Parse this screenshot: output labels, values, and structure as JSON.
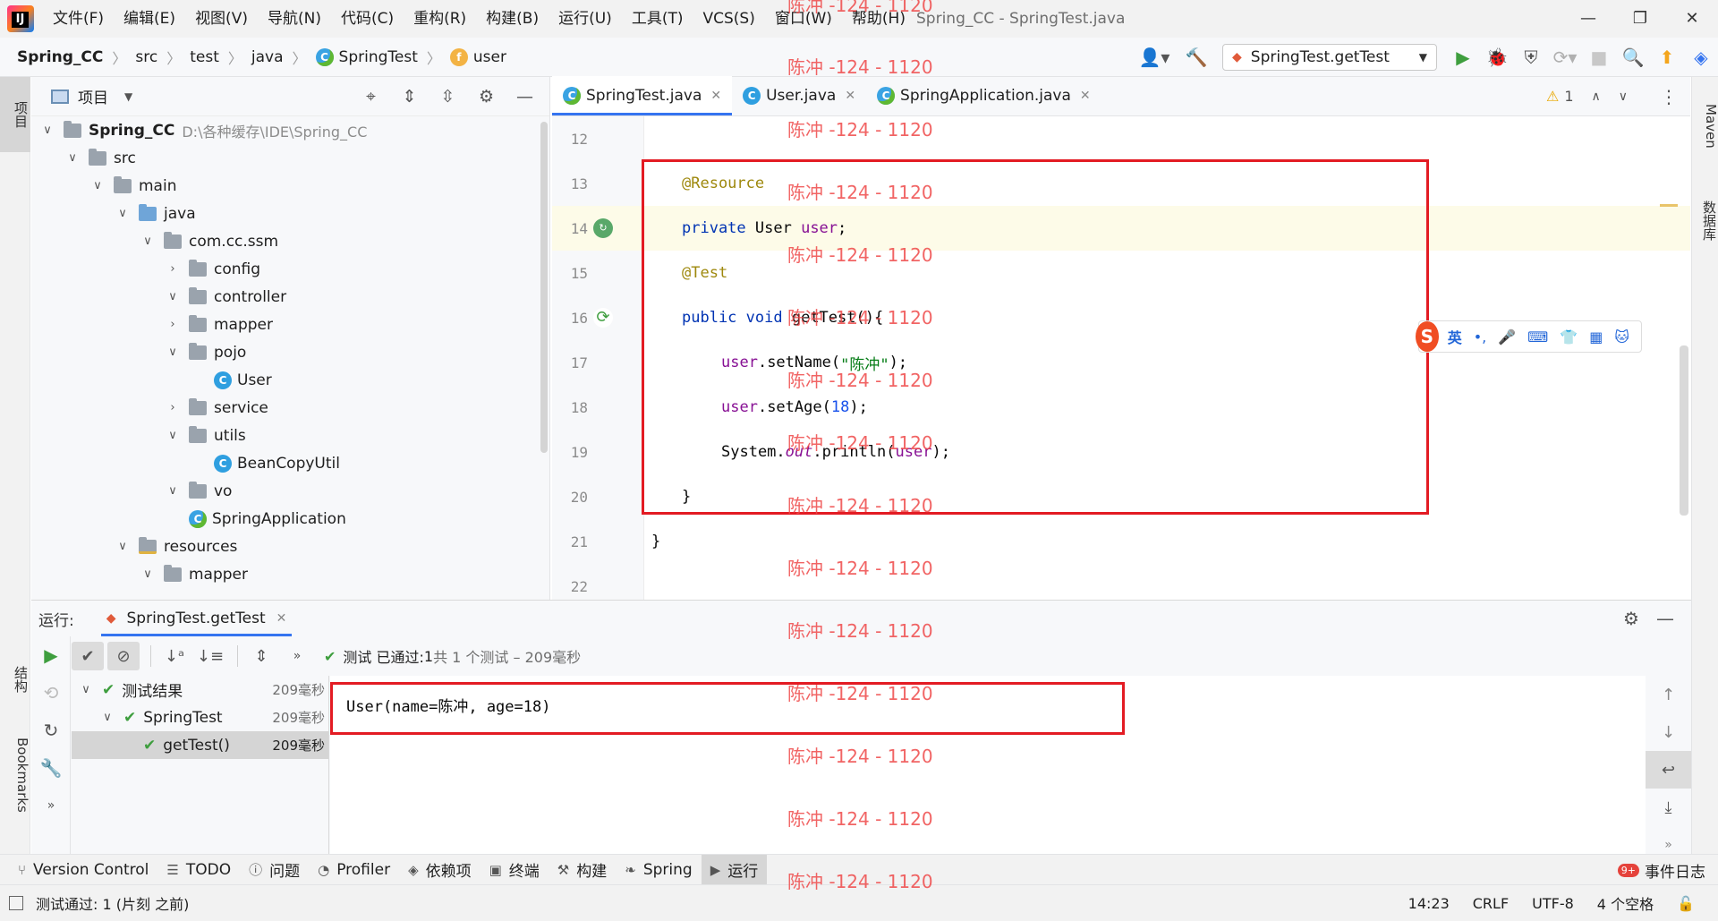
{
  "menu": {
    "items": [
      "文件(F)",
      "编辑(E)",
      "视图(V)",
      "导航(N)",
      "代码(C)",
      "重构(R)",
      "构建(B)",
      "运行(U)",
      "工具(T)",
      "VCS(S)",
      "窗口(W)",
      "帮助(H)"
    ],
    "window_title": "Spring_CC - SpringTest.java"
  },
  "breadcrumb": {
    "project": "Spring_CC",
    "path": [
      "src",
      "test",
      "java"
    ],
    "class": "SpringTest",
    "member": "user"
  },
  "toolbar": {
    "run_config": "SpringTest.getTest"
  },
  "left_stripe": {
    "project_tab": "项目",
    "structure_tab": "结构",
    "bookmarks_tab": "Bookmarks"
  },
  "right_stripe": {
    "maven_tab": "Maven",
    "database_tab": "数据库"
  },
  "project_panel": {
    "title": "项目",
    "root_name": "Spring_CC",
    "root_path": "D:\\各种缓存\\IDE\\Spring_CC",
    "nodes": [
      "src",
      "main",
      "java",
      "com.cc.ssm",
      "config",
      "controller",
      "mapper",
      "pojo",
      "User",
      "service",
      "utils",
      "BeanCopyUtil",
      "vo",
      "SpringApplication",
      "resources",
      "mapper"
    ]
  },
  "editor": {
    "tabs": [
      "SpringTest.java",
      "User.java",
      "SpringApplication.java"
    ],
    "inspection_count": "1",
    "line_numbers": [
      "12",
      "13",
      "14",
      "15",
      "16",
      "17",
      "18",
      "19",
      "20",
      "21",
      "22"
    ],
    "code": {
      "l13_annotation": "@Resource",
      "l14_kw": "private",
      "l14_type": " User ",
      "l14_field": "user",
      "l14_end": ";",
      "l15_annotation": "@Test",
      "l16_kw1": "public",
      "l16_kw2": " void",
      "l16_rest": " getTest(){",
      "l17_field": "user",
      "l17_call": ".setName(",
      "l17_str": "\"陈冲\"",
      "l17_end": ");",
      "l18_field": "user",
      "l18_call": ".setAge(",
      "l18_num": "18",
      "l18_end": ");",
      "l19_sys": "System.",
      "l19_out": "out",
      "l19_call": ".println(",
      "l19_field": "user",
      "l19_end": ");",
      "l20": "}",
      "l21": "}"
    }
  },
  "ime": {
    "logo": "S",
    "lang": "英",
    "items": [
      "•,",
      "🎤",
      "⌨",
      "👕",
      "▦",
      "🐱"
    ]
  },
  "run_panel": {
    "label": "运行:",
    "tab": "SpringTest.getTest",
    "status_prefix": "测试 已通过: ",
    "status_count": "1",
    "status_detail": "共 1 个测试 – 209毫秒",
    "tree": [
      {
        "label": "测试结果",
        "time": "209毫秒"
      },
      {
        "label": "SpringTest",
        "time": "209毫秒"
      },
      {
        "label": "getTest()",
        "time": "209毫秒"
      }
    ],
    "console_output": "User(name=陈冲, age=18)"
  },
  "tool_windows": {
    "items": [
      "Version Control",
      "TODO",
      "问题",
      "Profiler",
      "依赖项",
      "终端",
      "构建",
      "Spring",
      "运行"
    ],
    "event_badge": "9+",
    "event_log": "事件日志"
  },
  "status_bar": {
    "message": "测试通过: 1 (片刻 之前)",
    "position": "14:23",
    "line_sep": "CRLF",
    "encoding": "UTF-8",
    "indent": "4 个空格"
  },
  "watermark": {
    "text": "陈冲 -124 - 1120"
  },
  "colors": {
    "accent": "#3574f0",
    "highlight_box": "#e31b23",
    "pass_green": "#3e9e3e",
    "watermark": "#ef4a4a"
  }
}
